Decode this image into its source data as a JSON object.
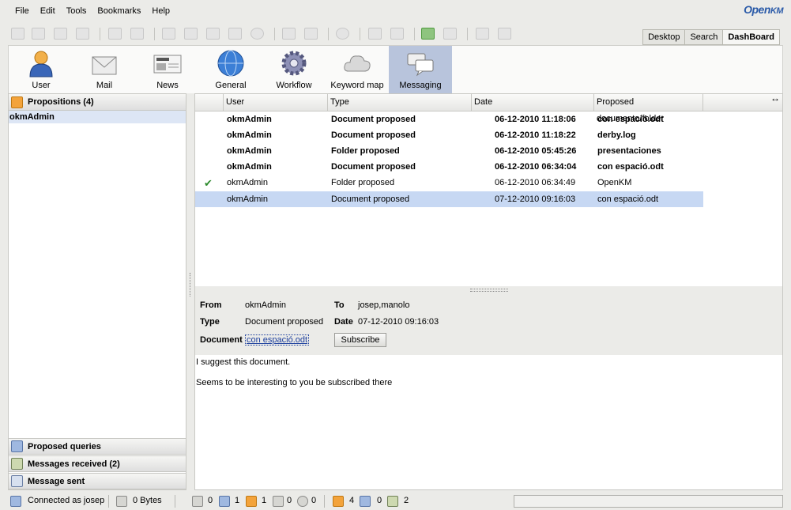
{
  "menu": [
    "File",
    "Edit",
    "Tools",
    "Bookmarks",
    "Help"
  ],
  "logo": {
    "a": "Open",
    "b": "KM"
  },
  "view_tabs": [
    "Desktop",
    "Search",
    "DashBoard"
  ],
  "dashboard": {
    "buttons": [
      {
        "label": "User",
        "icon": "user-icon"
      },
      {
        "label": "Mail",
        "icon": "mail-icon"
      },
      {
        "label": "News",
        "icon": "news-icon"
      },
      {
        "label": "General",
        "icon": "globe-icon"
      },
      {
        "label": "Workflow",
        "icon": "gear-icon"
      },
      {
        "label": "Keyword map",
        "icon": "cloud-icon"
      },
      {
        "label": "Messaging",
        "icon": "chat-bubbles-icon"
      }
    ],
    "active": "Messaging"
  },
  "left": {
    "propositions": "Propositions (4)",
    "selected_user": "okmAdmin",
    "proposed_queries": "Proposed queries",
    "messages_received": "Messages received (2)",
    "message_sent": "Message sent"
  },
  "table": {
    "headers": [
      "User",
      "Type",
      "Date",
      "Proposed documento/folder"
    ],
    "rows": [
      {
        "user": "okmAdmin",
        "type": "Document proposed",
        "date": "06-12-2010 11:18:06",
        "item": "con espació.odt",
        "unread": true
      },
      {
        "user": "okmAdmin",
        "type": "Document proposed",
        "date": "06-12-2010 11:18:22",
        "item": "derby.log",
        "unread": true
      },
      {
        "user": "okmAdmin",
        "type": "Folder proposed",
        "date": "06-12-2010 05:45:26",
        "item": "presentaciones",
        "unread": true
      },
      {
        "user": "okmAdmin",
        "type": "Document proposed",
        "date": "06-12-2010 06:34:04",
        "item": "con espació.odt",
        "unread": true
      },
      {
        "user": "okmAdmin",
        "type": "Folder proposed",
        "date": "06-12-2010 06:34:49",
        "item": "OpenKM",
        "unread": false,
        "accepted": true
      },
      {
        "user": "okmAdmin",
        "type": "Document proposed",
        "date": "07-12-2010 09:16:03",
        "item": "con espació.odt",
        "unread": false,
        "selected": true
      }
    ]
  },
  "detail": {
    "from_label": "From",
    "from": "okmAdmin",
    "to_label": "To",
    "to": "josep,manolo",
    "type_label": "Type",
    "type": "Document proposed",
    "date_label": "Date",
    "date": "07-12-2010 09:16:03",
    "doc_label": "Document",
    "doc": "con espació.odt",
    "subscribe": "Subscribe",
    "line1": "I suggest this document.",
    "line2": "Seems to be interesting to you be subscribed there"
  },
  "status": {
    "connected": "Connected as josep",
    "bytes": "0 Bytes",
    "locked": "0",
    "checkout": "1",
    "mail": "1",
    "tags": "0",
    "workflow": "0",
    "prop": "4",
    "queries": "0",
    "received": "2"
  }
}
